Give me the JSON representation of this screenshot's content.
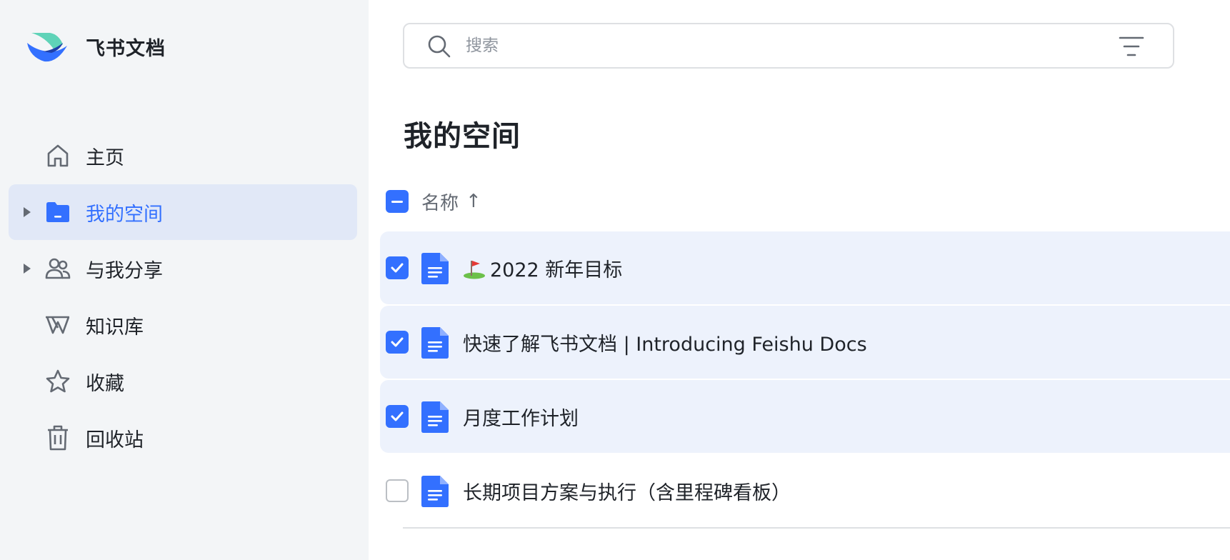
{
  "app": {
    "name": "飞书文档"
  },
  "sidebar": {
    "items": [
      {
        "label": "主页",
        "icon": "home-icon",
        "active": false,
        "expandable": false
      },
      {
        "label": "我的空间",
        "icon": "folder-icon",
        "active": true,
        "expandable": true
      },
      {
        "label": "与我分享",
        "icon": "people-icon",
        "active": false,
        "expandable": true
      },
      {
        "label": "知识库",
        "icon": "wiki-icon",
        "active": false,
        "expandable": false
      },
      {
        "label": "收藏",
        "icon": "star-icon",
        "active": false,
        "expandable": false
      },
      {
        "label": "回收站",
        "icon": "trash-icon",
        "active": false,
        "expandable": false
      }
    ]
  },
  "search": {
    "placeholder": "搜索"
  },
  "main": {
    "title": "我的空间",
    "list_header": {
      "column_name": "名称",
      "sort_indicator": "↑",
      "select_state": "indeterminate"
    },
    "rows": [
      {
        "emoji": "golf-flag-icon",
        "title": "2022 新年目标",
        "selected": true,
        "icon": "doc-icon"
      },
      {
        "title": "快速了解飞书文档 | Introducing Feishu Docs",
        "selected": true,
        "icon": "doc-icon"
      },
      {
        "title": "月度工作计划",
        "selected": true,
        "icon": "doc-icon"
      },
      {
        "title": "长期项目方案与执行（含里程碑看板）",
        "selected": false,
        "icon": "doc-icon"
      }
    ]
  },
  "colors": {
    "accent": "#3370ff",
    "sidebar_bg": "#f3f5f7",
    "active_item_bg": "#e1e8f7",
    "selected_row_bg": "#edf2fc",
    "text_primary": "#1f2329",
    "text_secondary": "#646a73"
  }
}
